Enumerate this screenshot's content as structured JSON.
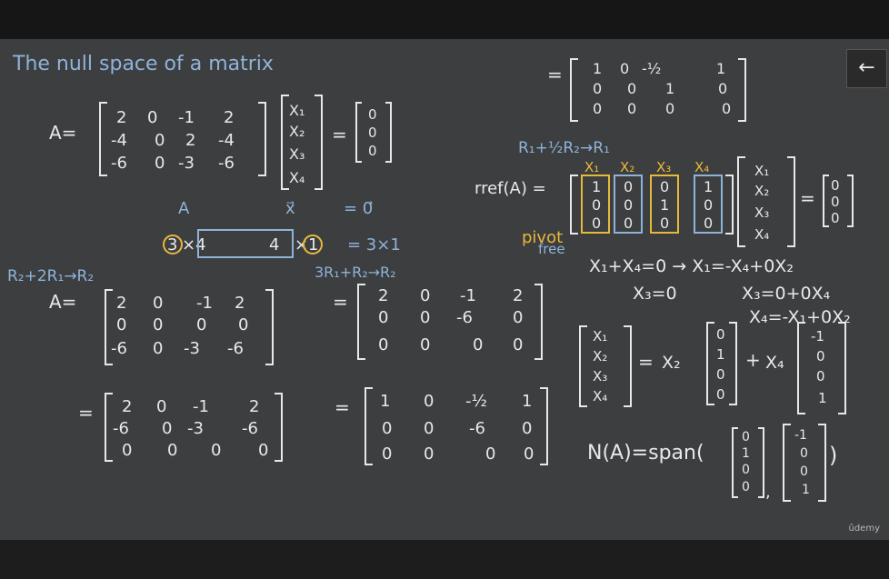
{
  "title": "The null space of a matrix",
  "matrix_A": {
    "label": "A=",
    "rows": [
      [
        "2",
        "0",
        "-1",
        "2"
      ],
      [
        "-4",
        "0",
        "2",
        "-4"
      ],
      [
        "-6",
        "0",
        "-3",
        "-6"
      ]
    ]
  },
  "vector_x": [
    "X₁",
    "X₂",
    "X₃",
    "X₄"
  ],
  "zero_vec": [
    "0",
    "0",
    "0"
  ],
  "eq_labels": {
    "A": "A",
    "x": "x⃗",
    "zero": "= 0⃗"
  },
  "dims": {
    "rows_circle": "3",
    "x4": "×4",
    "four": "4",
    "times": "×",
    "one_circle": "1",
    "result": "= 3×1"
  },
  "op1": "R₂+2R₁→R₂",
  "op2": "3R₁+R₂→R₂",
  "op3": "R₁+½R₂→R₁",
  "step1": {
    "label": "A=",
    "rows": [
      [
        "2",
        "0",
        "-1",
        "2"
      ],
      [
        "0",
        "0",
        "0",
        "0"
      ],
      [
        "-6",
        "0",
        "-3",
        "-6"
      ]
    ]
  },
  "step2": {
    "rows": [
      [
        "2",
        "0",
        "-1",
        "2"
      ],
      [
        "-6",
        "0",
        "-3",
        "-6"
      ],
      [
        "0",
        "0",
        "0",
        "0"
      ]
    ]
  },
  "step3": {
    "rows": [
      [
        "2",
        "0",
        "-1",
        "2"
      ],
      [
        "0",
        "0",
        "-6",
        "0"
      ],
      [
        "0",
        "0",
        "0",
        "0"
      ]
    ]
  },
  "step4": {
    "rows": [
      [
        "1",
        "0",
        "-½",
        "1"
      ],
      [
        "0",
        "0",
        "-6",
        "0"
      ],
      [
        "0",
        "0",
        "0",
        "0"
      ]
    ]
  },
  "top_right": {
    "rows": [
      [
        "1",
        "0",
        "-½",
        "1"
      ],
      [
        "0",
        "0",
        "1",
        "0"
      ],
      [
        "0",
        "0",
        "0",
        "0"
      ]
    ]
  },
  "rref": {
    "label": "rref(A) =",
    "col_headers": [
      "X₁",
      "X₂",
      "X₃",
      "X₄"
    ],
    "cols": [
      [
        "1",
        "0",
        "0"
      ],
      [
        "0",
        "0",
        "0"
      ],
      [
        "0",
        "1",
        "0"
      ],
      [
        "1",
        "0",
        "0"
      ]
    ],
    "pivot": "pivot",
    "free": "free"
  },
  "equations": [
    "X₁+X₄=0 → X₁=-X₄+0X₂",
    "X₃=0",
    "X₃=0+0X₄",
    "X₄=-X₁+0X₂"
  ],
  "param": {
    "x2": "X₂",
    "x4": "X₄",
    "v2": [
      "0",
      "1",
      "0",
      "0"
    ],
    "v4": [
      "-1",
      "0",
      "0",
      "1"
    ]
  },
  "null_space": "N(A)=span(",
  "watermark": "ûdemy",
  "back_icon": "←",
  "colors": {
    "white": "#e8e8e8",
    "blue": "#8fb3d8",
    "yellow": "#e8b83b",
    "board": "#3c3e40"
  }
}
